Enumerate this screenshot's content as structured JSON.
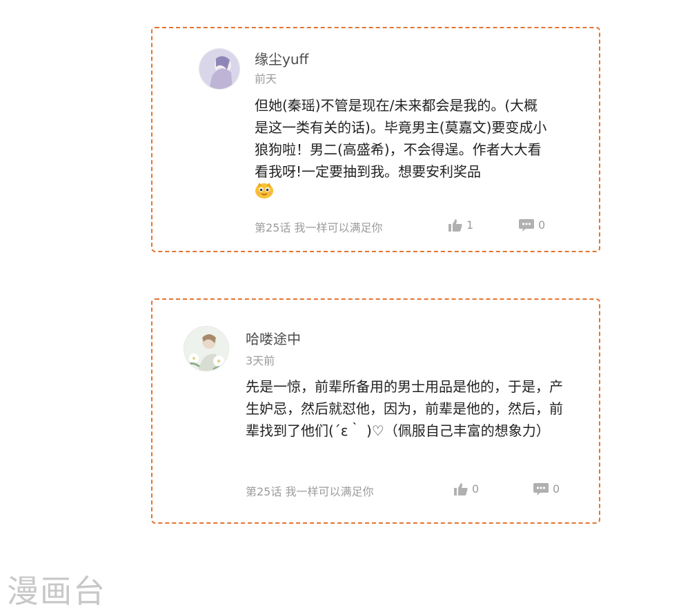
{
  "comments": [
    {
      "username": "缘尘yuff",
      "time": "前天",
      "content": "但她(秦瑶)不管是现在/未来都会是我的。(大概是这一类有关的话)。毕竟男主(莫嘉文)要变成小狼狗啦！男二(高盛希)，不会得逞。作者大大看看我呀!一定要抽到我。想要安利奖品",
      "emoji": "smile-emoji",
      "episode": "第25话 我一样可以满足你",
      "likes": "1",
      "replies": "0"
    },
    {
      "username": "哈喽途中",
      "time": "3天前",
      "content": "先是一惊，前辈所备用的男士用品是他的，于是，产生妒忌，然后就怼他，因为，前辈是他的，然后，前辈找到了他们(´ε｀ )♡（佩服自己丰富的想象力）",
      "episode": "第25话 我一样可以满足你",
      "likes": "0",
      "replies": "0"
    }
  ],
  "watermark": "漫画台",
  "colors": {
    "border": "#e2732f",
    "meta": "#9b9b9b",
    "text": "#222222"
  }
}
